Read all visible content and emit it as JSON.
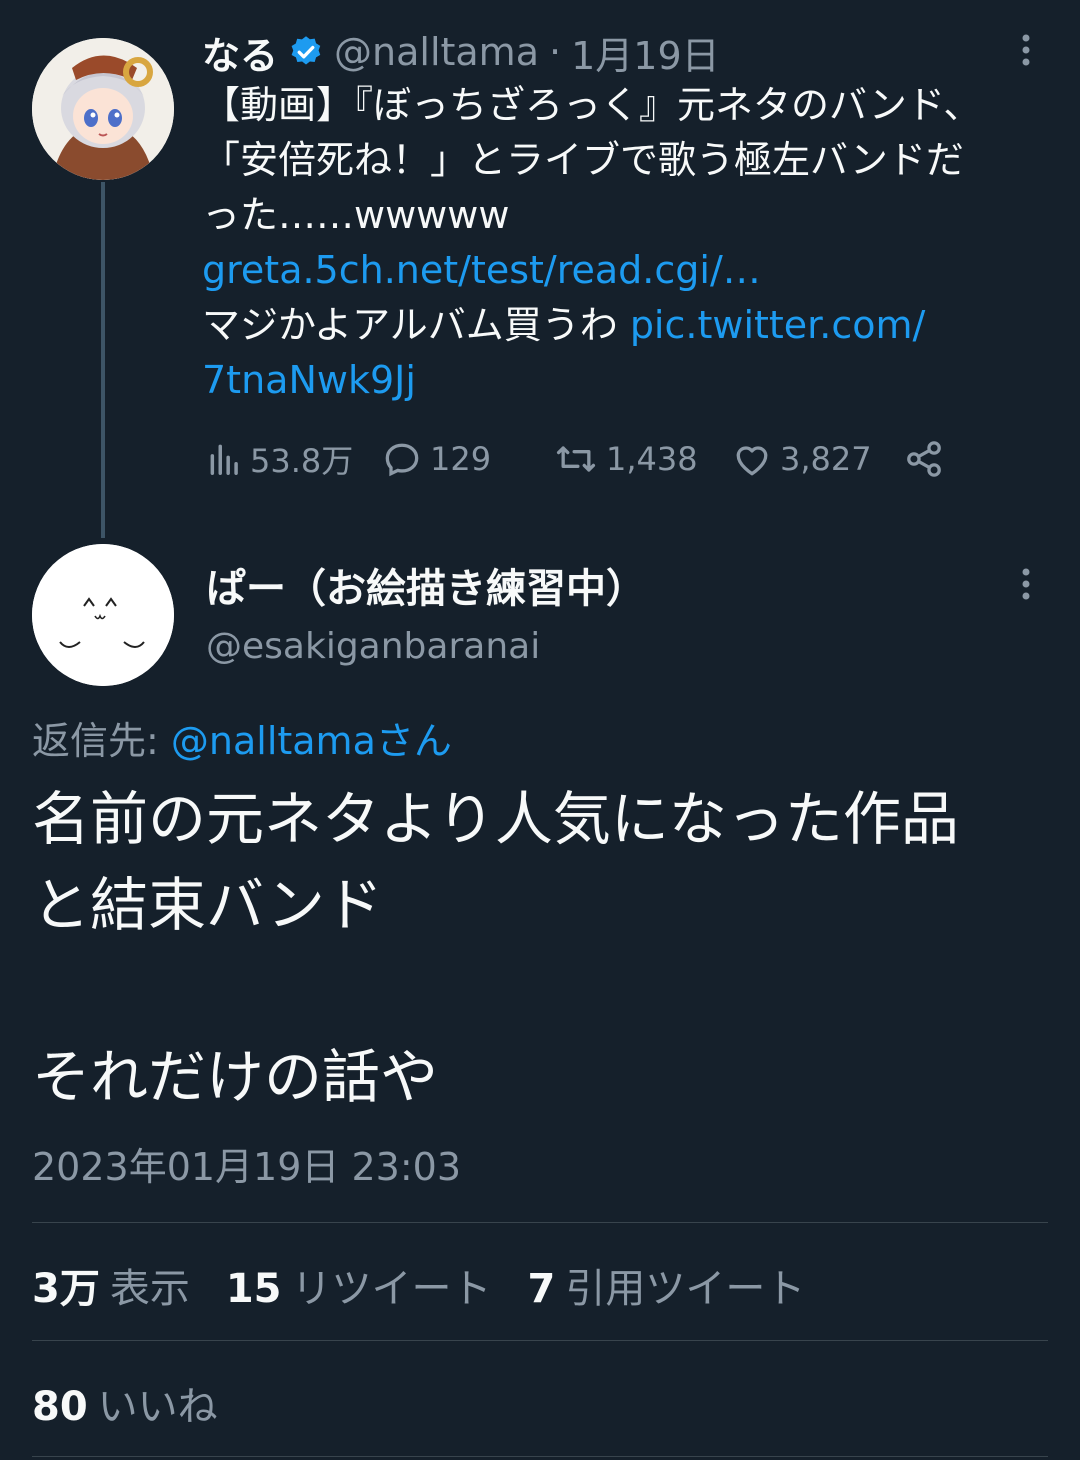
{
  "parent_tweet": {
    "display_name": "なる",
    "handle": "@nalltama",
    "separator": "·",
    "date": "1月19日",
    "text_lines": [
      "【動画】『ぼっちざろっく』元ネタのバンド、",
      "「安倍死ね！」とライブで歌う極左バンドだ",
      "った……wwwww"
    ],
    "link1": "greta.5ch.net/test/read.cgi/…",
    "text_after_link": "マジかよアルバム買うわ ",
    "link2_part1": "pic.twitter.com/",
    "link2_part2": "7tnaNwk9Jj",
    "views": "53.8万",
    "replies": "129",
    "retweets": "1,438",
    "likes": "3,827"
  },
  "reply_tweet": {
    "display_name": "ぱー（お絵描き練習中）",
    "handle": "@esakiganbaranai",
    "reply_to_prefix": "返信先: ",
    "reply_to_handle": "@nalltamaさん",
    "text_lines": [
      "名前の元ネタより人気になった作品",
      "と結束バンド",
      "",
      "それだけの話や"
    ],
    "timestamp": "2023年01月19日 23:03"
  },
  "stats": {
    "views_count": "3万",
    "views_label": "表示",
    "retweets_count": "15",
    "retweets_label": "リツイート",
    "quotes_count": "7",
    "quotes_label": "引用ツイート",
    "likes_count": "80",
    "likes_label": "いいね"
  },
  "colors": {
    "background": "#15202b",
    "link": "#1d9bf0",
    "muted": "#8b98a5",
    "text": "#f7f9f9"
  }
}
